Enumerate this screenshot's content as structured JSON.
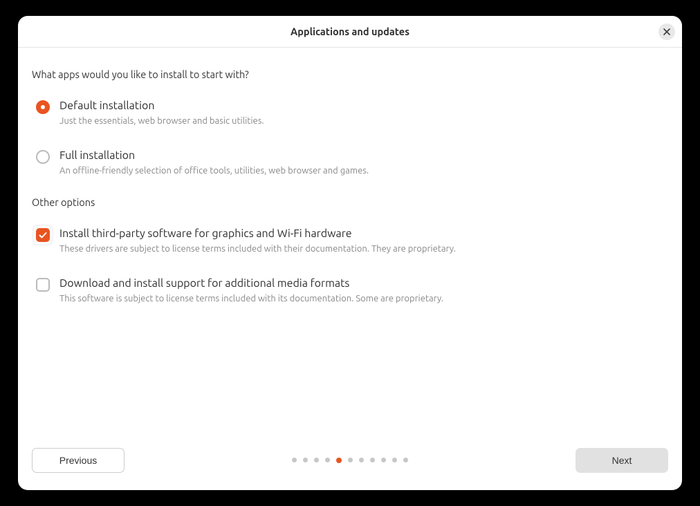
{
  "title": "Applications and updates",
  "question": "What apps would you like to install to start with?",
  "radios": [
    {
      "label": "Default installation",
      "desc": "Just the essentials, web browser and basic utilities.",
      "selected": true
    },
    {
      "label": "Full installation",
      "desc": "An offline-friendly selection of office tools, utilities, web browser and games.",
      "selected": false
    }
  ],
  "other_heading": "Other options",
  "checkboxes": [
    {
      "label": "Install third-party software for graphics and Wi-Fi hardware",
      "desc": "These drivers are subject to license terms included with their documentation. They are proprietary.",
      "checked": true,
      "focused": true
    },
    {
      "label": "Download and install support for additional media formats",
      "desc": "This software is subject to license terms included with its documentation. Some are proprietary.",
      "checked": false,
      "focused": false
    }
  ],
  "footer": {
    "prev": "Previous",
    "next": "Next"
  },
  "pager": {
    "total": 11,
    "current": 5
  }
}
